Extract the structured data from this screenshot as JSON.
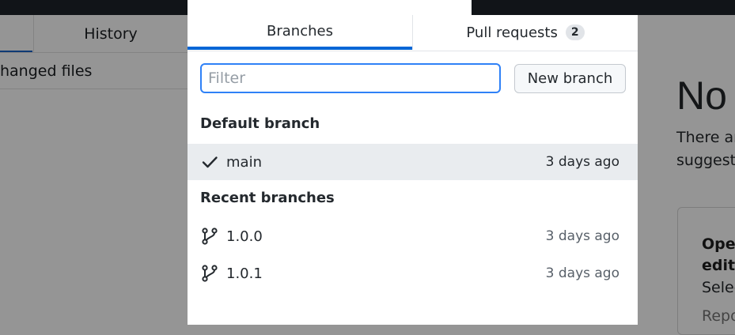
{
  "background": {
    "left_tabs": {
      "history_label": "History"
    },
    "changed_files_label": "hanged files",
    "right_panel": {
      "heading": "No",
      "text_line1": "There ar",
      "text_line2": "suggesti",
      "card_title_line1": "Oper",
      "card_title_line2": "edito",
      "card_text_line1": "Selec",
      "card_text_line2": "Repo"
    }
  },
  "popover": {
    "tabs": [
      {
        "label": "Branches",
        "active": true
      },
      {
        "label": "Pull requests",
        "count": "2",
        "active": false
      }
    ],
    "filter": {
      "placeholder": "Filter",
      "value": ""
    },
    "new_branch_label": "New branch",
    "sections": {
      "default": {
        "title": "Default branch",
        "branches": [
          {
            "name": "main",
            "time": "3 days ago",
            "icon": "check-icon",
            "selected": true
          }
        ]
      },
      "recent": {
        "title": "Recent branches",
        "branches": [
          {
            "name": "1.0.0",
            "time": "3 days ago",
            "icon": "git-branch-icon"
          },
          {
            "name": "1.0.1",
            "time": "3 days ago",
            "icon": "git-branch-icon"
          }
        ]
      }
    }
  },
  "colors": {
    "accent": "#0366d6",
    "focus_border": "#2f81f7",
    "selected_row": "#e9ecef",
    "overlay_gray": "#959595"
  }
}
